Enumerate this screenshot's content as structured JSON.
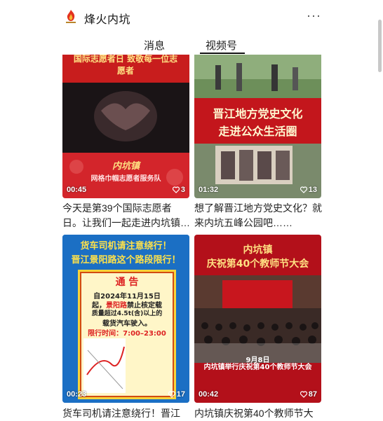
{
  "header": {
    "title": "烽火内坑",
    "more_icon": "···"
  },
  "tabs": [
    {
      "label": "消息"
    },
    {
      "label": "视频号"
    }
  ],
  "colors": {
    "red_banner": "#d2141f",
    "blue_poster": "#1b6fc4",
    "yellow_notice": "#f7d43a"
  },
  "videos": [
    {
      "duration": "00:45",
      "likes": "3",
      "caption": "今天是第39个国际志愿者日。让我们一起走进内坑镇…",
      "banner_top": "国际志愿者日 致敬每一位志愿者",
      "banner_bottom": "内坑镇",
      "banner_bottom2": "网格巾帼志愿者服务队"
    },
    {
      "duration": "01:32",
      "likes": "13",
      "caption": "想了解晋江地方党史文化？就来内坑五峰公园吧……",
      "headline1": "晋江地方党史文化",
      "headline2": "走进公众生活圈"
    },
    {
      "duration": "00:23",
      "likes": "17",
      "caption": "货车司机请注意绕行！晋江",
      "headline1": "货车司机请注意绕行！",
      "headline2": "晋江景阳路这个路段限行！",
      "notice_title": "通 告",
      "notice_body1": "自2024年11月15日",
      "notice_body2a": "起，",
      "notice_body2b": "景阳路",
      "notice_body2c": "禁止核定载",
      "notice_body3": "质量超过4.5t(含)以上的",
      "notice_body4": "载货汽车驶入。",
      "notice_time": "限行时间：7:00–23:00"
    },
    {
      "duration": "00:42",
      "likes": "87",
      "caption": "内坑镇庆祝第40个教师节大",
      "headline1": "内坑镇",
      "headline2": "庆祝第40个教师节大会",
      "date_line": "9月8日",
      "footer_line": "内坑镇举行庆祝第40个教师节大会"
    }
  ]
}
